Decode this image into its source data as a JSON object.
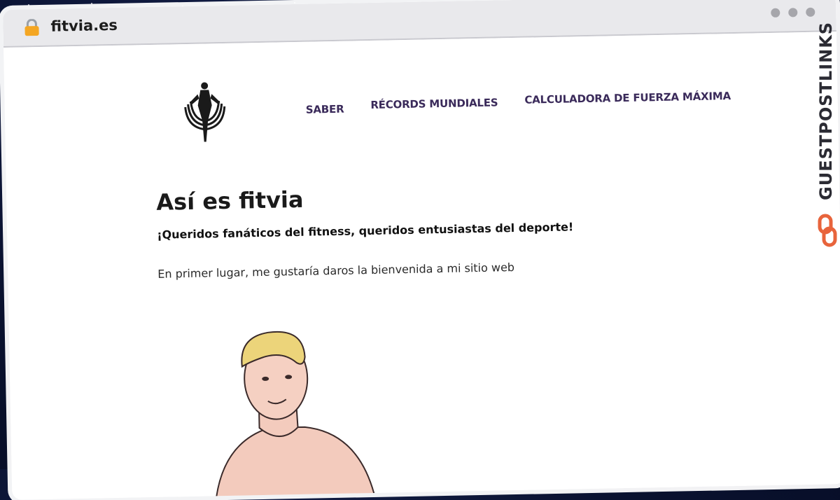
{
  "browser": {
    "url": "fitvia.es",
    "icons": {
      "lock": "lock-icon",
      "window_dots": "window-controls"
    }
  },
  "site": {
    "nav": [
      {
        "label": "SABER"
      },
      {
        "label": "RÉCORDS MUNDIALES"
      },
      {
        "label": "CALCULADORA DE FUERZA MÁXIMA"
      }
    ],
    "headline": "Así es fitvia",
    "subhead": "¡Queridos fanáticos del fitness, queridos entusiastas del deporte!",
    "intro": "En primer lugar, me gustaría daros la bienvenida a mi sitio web"
  },
  "watermark": {
    "text": "GUESTPOSTLINKS",
    "accent": "#e8643c"
  },
  "colors": {
    "nav": "#3a2a5a",
    "frame": "#e9e9ec",
    "background": "#0a1230"
  }
}
